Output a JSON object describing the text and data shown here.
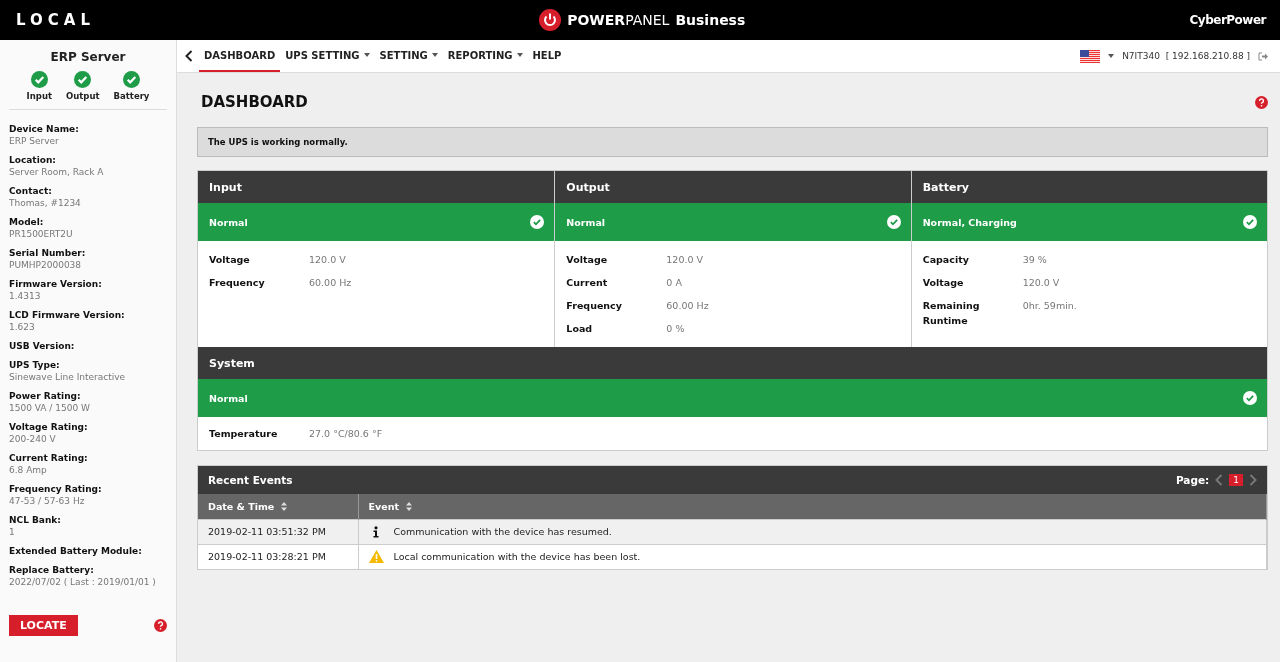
{
  "header": {
    "mode": "LOCAL",
    "brand_strong": "POWER",
    "brand_light": "PANEL",
    "edition": "Business",
    "vendor": "CyberPower"
  },
  "sidebar": {
    "device": "ERP Server",
    "status": [
      {
        "label": "Input",
        "ok": true
      },
      {
        "label": "Output",
        "ok": true
      },
      {
        "label": "Battery",
        "ok": true
      }
    ],
    "fields": [
      {
        "label": "Device Name:",
        "value": "ERP Server"
      },
      {
        "label": "Location:",
        "value": "Server Room, Rack A"
      },
      {
        "label": "Contact:",
        "value": "Thomas, #1234"
      },
      {
        "label": "Model:",
        "value": "PR1500ERT2U"
      },
      {
        "label": "Serial Number:",
        "value": "PUMHP2000038"
      },
      {
        "label": "Firmware Version:",
        "value": "1.4313"
      },
      {
        "label": "LCD Firmware Version:",
        "value": "1.623"
      },
      {
        "label": "USB Version:"
      },
      {
        "label": "UPS Type:",
        "value": "Sinewave Line Interactive"
      },
      {
        "label": "Power Rating:",
        "value": "1500 VA / 1500 W"
      },
      {
        "label": "Voltage Rating:",
        "value": "200-240 V"
      },
      {
        "label": "Current Rating:",
        "value": "6.8 Amp"
      },
      {
        "label": "Frequency Rating:",
        "value": "47-53 / 57-63 Hz"
      },
      {
        "label": "NCL Bank:",
        "value": "1"
      },
      {
        "label": "Extended Battery Module:"
      },
      {
        "label": "Replace Battery:",
        "value": "2022/07/02 ( Last : 2019/01/01 )"
      }
    ],
    "locate_button": "LOCATE"
  },
  "nav": {
    "tabs": [
      {
        "label": "DASHBOARD",
        "selected": true,
        "dropdown": false
      },
      {
        "label": "UPS SETTING",
        "selected": false,
        "dropdown": true
      },
      {
        "label": "SETTING",
        "selected": false,
        "dropdown": true
      },
      {
        "label": "REPORTING",
        "selected": false,
        "dropdown": true
      },
      {
        "label": "HELP",
        "selected": false,
        "dropdown": false
      }
    ],
    "host": "N7IT340",
    "ip": "[ 192.168.210.88 ]"
  },
  "page_title": "DASHBOARD",
  "message": "The UPS is working normally.",
  "panels": [
    {
      "title": "Input",
      "status": "Normal",
      "ok": true,
      "rows": [
        {
          "label": "Voltage",
          "value": "120.0 V"
        },
        {
          "label": "Frequency",
          "value": "60.00 Hz"
        }
      ]
    },
    {
      "title": "Output",
      "status": "Normal",
      "ok": true,
      "rows": [
        {
          "label": "Voltage",
          "value": "120.0 V"
        },
        {
          "label": "Current",
          "value": "0 A"
        },
        {
          "label": "Frequency",
          "value": "60.00 Hz"
        },
        {
          "label": "Load",
          "value": "0 %"
        }
      ]
    },
    {
      "title": "Battery",
      "status": "Normal, Charging",
      "ok": true,
      "rows": [
        {
          "label": "Capacity",
          "value": "39 %"
        },
        {
          "label": "Voltage",
          "value": "120.0 V"
        },
        {
          "label": "Remaining Runtime",
          "value": "0hr. 59min."
        }
      ]
    }
  ],
  "system": {
    "title": "System",
    "status": "Normal",
    "ok": true,
    "rows": [
      {
        "label": "Temperature",
        "value": "27.0 °C/80.6 °F"
      }
    ]
  },
  "events": {
    "title": "Recent Events",
    "page_label": "Page:",
    "pages": [
      {
        "label": "1",
        "selected": true
      }
    ],
    "columns": [
      "Date & Time",
      "Event"
    ],
    "rows": [
      {
        "time": "2019-02-11 03:51:32 PM",
        "kind": "info",
        "text": "Communication with the device has resumed."
      },
      {
        "time": "2019-02-11 03:28:21 PM",
        "kind": "warning",
        "text": "Local communication with the device has been lost."
      }
    ]
  }
}
